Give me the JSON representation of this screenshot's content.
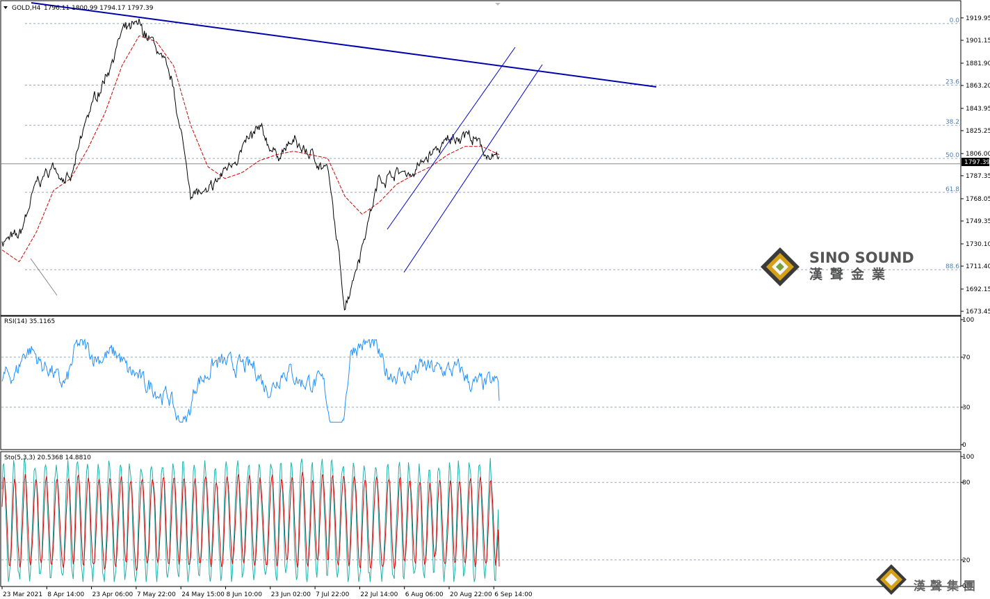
{
  "header": {
    "symbol": "GOLD,H4",
    "ohlc": "1796.11 1800.99 1794.17 1797.39"
  },
  "price_axis": {
    "ticks": [
      "1919.95",
      "1901.15",
      "1881.90",
      "1863.20",
      "1843.95",
      "1825.25",
      "1806.00",
      "1787.35",
      "1768.05",
      "1749.35",
      "1730.10",
      "1711.40",
      "1692.15",
      "1673.45"
    ],
    "current_price": "1797.39"
  },
  "fib_levels": [
    {
      "label": "0.0",
      "price": 1915.2
    },
    {
      "label": "23.6",
      "price": 1863.5
    },
    {
      "label": "38.2",
      "price": 1829.8
    },
    {
      "label": "50.0",
      "price": 1801.9
    },
    {
      "label": "61.8",
      "price": 1773.4
    },
    {
      "label": "88.6",
      "price": 1708.4
    }
  ],
  "time_axis": [
    "23 Mar 2021",
    "8 Apr 14:00",
    "23 Apr 06:00",
    "7 May 22:00",
    "24 May 15:00",
    "8 Jun 10:00",
    "23 Jun 02:00",
    "7 Jul 22:00",
    "22 Jul 14:00",
    "6 Aug 06:00",
    "20 Aug 22:00",
    "6 Sep 14:00"
  ],
  "rsi": {
    "label": "RSI(14) 35.1165",
    "ticks": [
      "100",
      "70",
      "30",
      "0"
    ]
  },
  "stoch": {
    "label": "Sto(5,3,3) 20.5368 14.8810",
    "ticks": [
      "100",
      "80",
      "20",
      "0"
    ]
  },
  "watermark": {
    "brand_en": "SINO SOUND",
    "brand_cn": "漢聲金業",
    "footer_cn": "漢聲集團"
  },
  "colors": {
    "price_line": "#000000",
    "ma_line": "#cc0000",
    "trend_line": "#0000aa",
    "rsi_line": "#1e90ff",
    "stoch_main": "#20b2aa",
    "stoch_signal": "#dd0000",
    "grid": "#9aa8b8"
  },
  "chart_data": {
    "type": "line",
    "symbol": "GOLD",
    "timeframe": "H4",
    "x": [
      "23 Mar 2021",
      "8 Apr",
      "23 Apr",
      "7 May",
      "24 May",
      "8 Jun",
      "23 Jun",
      "7 Jul",
      "22 Jul",
      "6 Aug",
      "20 Aug",
      "6 Sep"
    ],
    "series": [
      {
        "values": [
          1733,
          1735,
          1780,
          1795,
          1782,
          1838,
          1870,
          1908,
          1912,
          1895,
          1860,
          1775,
          1770,
          1792,
          1810,
          1825,
          1805,
          1815,
          1805,
          1792,
          1678,
          1730,
          1785,
          1790,
          1790,
          1805,
          1815,
          1825,
          1810,
          1797
        ]
      },
      {
        "values": [
          1725,
          1715,
          1740,
          1775,
          1785,
          1810,
          1840,
          1880,
          1905,
          1900,
          1880,
          1830,
          1795,
          1785,
          1790,
          1800,
          1805,
          1808,
          1805,
          1802,
          1770,
          1755,
          1765,
          1780,
          1788,
          1795,
          1805,
          1812,
          1812,
          1805
        ]
      }
    ],
    "ylim": [
      1673.45,
      1928
    ],
    "rsi_14": {
      "ylim": [
        0,
        100
      ],
      "levels": [
        70,
        30
      ],
      "last": 35.1165
    },
    "stochastic_5_3_3": {
      "ylim": [
        0,
        100
      ],
      "levels": [
        80,
        20
      ],
      "main_last": 20.5368,
      "signal_last": 14.881
    }
  }
}
